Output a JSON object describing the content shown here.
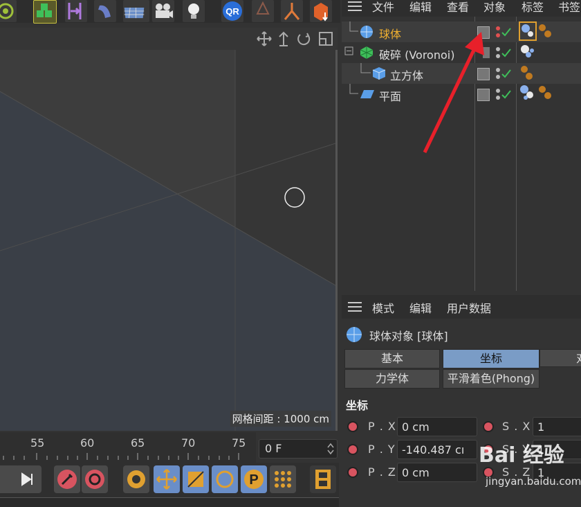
{
  "object_manager": {
    "menu": [
      "文件",
      "编辑",
      "查看",
      "对象",
      "标签",
      "书签"
    ],
    "objects": [
      {
        "name": "球体",
        "selected": true,
        "color": "#f0b030"
      },
      {
        "name": "破碎 (Voronoi)",
        "selected": false,
        "color": "#dddddd"
      },
      {
        "name": "立方体",
        "selected": false,
        "color": "#dddddd"
      },
      {
        "name": "平面",
        "selected": false,
        "color": "#dddddd"
      }
    ]
  },
  "viewport": {
    "grid_spacing": "网格间距 : 1000 cm"
  },
  "timeline": {
    "ticks": [
      "55",
      "60",
      "65",
      "70",
      "75"
    ],
    "current_frame": "0 F"
  },
  "attribute_manager": {
    "menu": [
      "模式",
      "编辑",
      "用户数据"
    ],
    "object_title": "球体对象 [球体]",
    "tabs_row1": [
      "基本",
      "坐标",
      "对"
    ],
    "tabs_row2": [
      "力学体",
      "平滑着色(Phong)"
    ],
    "active_tab": "坐标",
    "section_title": "坐标",
    "coords": [
      {
        "label": "P . X",
        "value": "0 cm",
        "s_label": "S . X",
        "s_value": "1"
      },
      {
        "label": "P . Y",
        "value": "-140.487 cı",
        "s_label": "S . Y",
        "s_value": "1"
      },
      {
        "label": "P . Z",
        "value": "0 cm",
        "s_label": "S . Z",
        "s_value": "1"
      }
    ]
  },
  "watermark": {
    "brand": "Bai 经验",
    "url": "jingyan.baidu.com"
  },
  "colors": {
    "accent": "#f0b030",
    "active_tab": "#7a9cc6",
    "radio": "#d85460",
    "arrow": "#e8202a"
  }
}
